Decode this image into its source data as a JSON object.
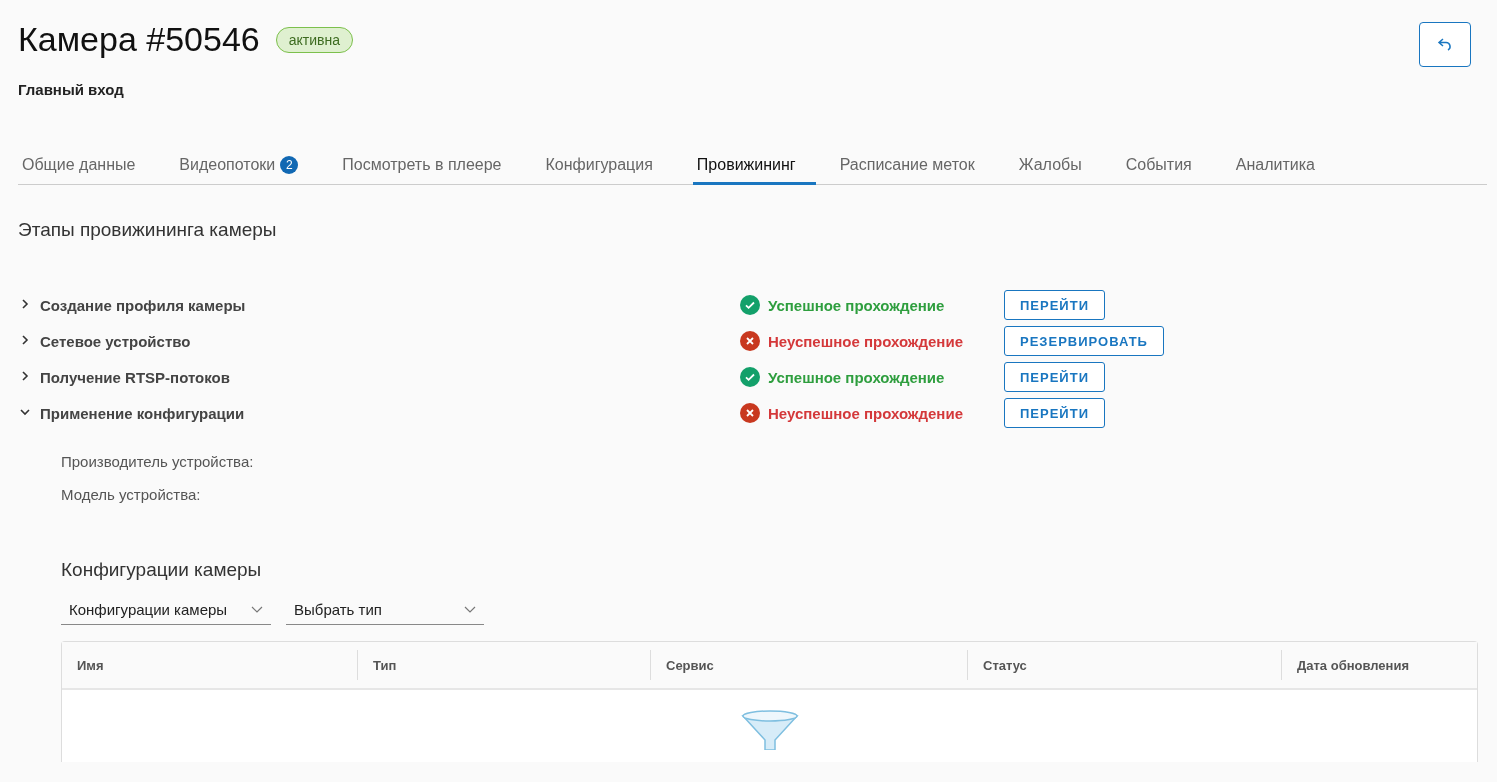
{
  "header": {
    "title": "Камера #50546",
    "status_badge": "активна",
    "subtitle": "Главный вход"
  },
  "tabs": [
    {
      "label": "Общие данные",
      "selected": false
    },
    {
      "label": "Видеопотоки",
      "count": "2",
      "selected": false
    },
    {
      "label": "Посмотреть в плеере",
      "selected": false
    },
    {
      "label": "Конфигурация",
      "selected": false
    },
    {
      "label": "Провижининг",
      "selected": true
    },
    {
      "label": "Расписание меток",
      "selected": false
    },
    {
      "label": "Жалобы",
      "selected": false
    },
    {
      "label": "События",
      "selected": false
    },
    {
      "label": "Аналитика",
      "selected": false
    }
  ],
  "section_title": "Этапы провижининга камеры",
  "stages": [
    {
      "name": "Создание профиля камеры",
      "expanded": false,
      "passed": true,
      "status": "Успешное прохождение",
      "action": "ПЕРЕЙТИ"
    },
    {
      "name": "Сетевое устройство",
      "expanded": false,
      "passed": false,
      "status": "Неуспешное прохождение",
      "action": "РЕЗЕРВИРОВАТЬ"
    },
    {
      "name": "Получение RTSP-потоков",
      "expanded": false,
      "passed": true,
      "status": "Успешное прохождение",
      "action": "ПЕРЕЙТИ"
    },
    {
      "name": "Применение конфигурации",
      "expanded": true,
      "passed": false,
      "status": "Неуспешное прохождение",
      "action": "ПЕРЕЙТИ",
      "details": [
        "Производитель устройства:",
        "Модель устройства:"
      ],
      "configs": {
        "title": "Конфигурации камеры",
        "filters": [
          "Конфигурации камеры",
          "Выбрать тип"
        ],
        "columns": [
          "Имя",
          "Тип",
          "Сервис",
          "Статус",
          "Дата обновления"
        ]
      }
    }
  ]
}
